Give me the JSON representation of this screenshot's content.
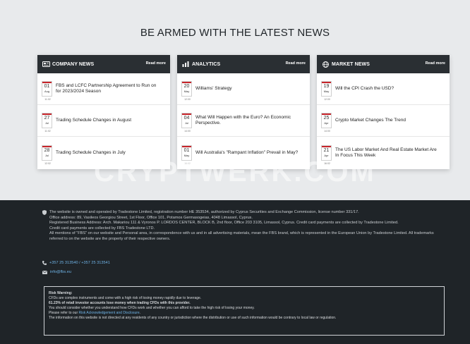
{
  "heading": "BE ARMED WITH THE LATEST NEWS",
  "read_more": "Read more",
  "cards": [
    {
      "title": "COMPANY NEWS",
      "items": [
        {
          "day": "01",
          "month": "Aug",
          "time": "11:02",
          "text": "FBS and LCFC Partnership Agreement to Run on for 2023/2024 Season"
        },
        {
          "day": "27",
          "month": "Jul",
          "time": "11:02",
          "text": "Trading Schedule Changes in August"
        },
        {
          "day": "28",
          "month": "Jul",
          "time": "12:02",
          "text": "Trading Schedule Changes in July"
        }
      ]
    },
    {
      "title": "ANALYTICS",
      "items": [
        {
          "day": "20",
          "month": "May",
          "time": "12:00",
          "text": "Williams' Strategy"
        },
        {
          "day": "04",
          "month": "Jul",
          "time": "14:00",
          "text": "What Will Happen with the Euro? An Economic Perspective."
        },
        {
          "day": "01",
          "month": "May",
          "time": "16:02",
          "text": "Will Australia's \"Rampant Inflation\" Prevail in May?"
        }
      ]
    },
    {
      "title": "MARKET NEWS",
      "items": [
        {
          "day": "19",
          "month": "May",
          "time": "12:00",
          "text": "Will the CPI Crash the USD?"
        },
        {
          "day": "25",
          "month": "Apr",
          "time": "14:00",
          "text": "Crypto Market Changes The Trend"
        },
        {
          "day": "21",
          "month": "Apr",
          "time": "16:02",
          "text": "The US Labor Market And Real Estate Market Are In Focus This Week"
        }
      ]
    }
  ],
  "watermark": "CRYPTWERK.COM",
  "footer": {
    "lines": [
      "The website is owned and operated by Tradestone Limited, registration number HE 353534, authorized by Cyprus Securities and Exchange Commission, license number 331/17.",
      "Office address: 89, Vasileos Georgiou Street, 1st Floor, Office 101, Potamos Germasogeias, 4048 Limassol, Cyprus.",
      "Registered Business Address: Arch. Makariou 111 & Vyronos P. LORDOS CENTER, BLOCK B, 2nd floor, Office 203 3105, Limassol, Cyprus. Credit card payments are collected by Tradestone Limited.",
      "Credit card payments are collected by FBS Tradestone LTD.",
      "All mentions of \"FBS\" on our website and Personal area, in correspondence with us and in all advertising materials, mean the FBS brand, which is represented in the European Union by Tradestone Limited. All trademarks referred to on the website are the property of their respective owners."
    ],
    "phone": "+357 25 313540 / +357 25 313541",
    "email": "info@fbs.eu"
  },
  "risk": {
    "title": "Risk Warning:",
    "line1": "CFDs are complex instruments and come with a high risk of losing money rapidly due to leverage.",
    "line2": "61.23% of retail investor accounts lose money when trading CFDs with this provider.",
    "line3": "You should consider whether you understand how CFDs work and whether you can afford to take the high risk of losing your money.",
    "line4_prefix": "Please refer to our ",
    "line4_link": "Risk Acknowledgement and Disclosure",
    "line4_suffix": ".",
    "line5": "The information on this website is not directed at any residents of any country or jurisdiction where the distribution or use of such information would be contrary to local law or regulation."
  }
}
